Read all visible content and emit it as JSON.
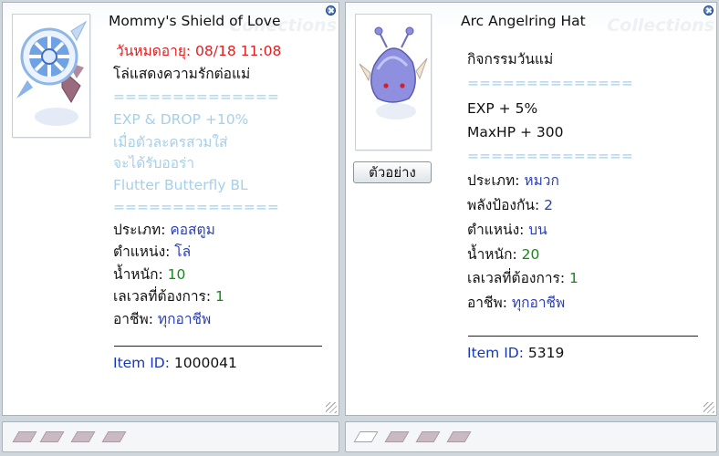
{
  "left_window": {
    "title": "Mommy's Shield of Love",
    "watermark": "Collections",
    "item_image": "shield-icon",
    "lines": {
      "expire": "วันหมดอายุ: 08/18 11:08",
      "desc": "โล่แสดงความรักต่อแม่",
      "sep1": "==============",
      "bonus1": "EXP & DROP +10%",
      "bonus2": "เมื่อตัวละครสวมใส่",
      "bonus3": "จะได้รับออร่า",
      "bonus4": "Flutter Butterfly BL",
      "sep2": "=============="
    },
    "stats": [
      {
        "label": "ประเภท: ",
        "value": "คอสตูม"
      },
      {
        "label": "ตำแหน่ง: ",
        "value": "โล่"
      },
      {
        "label": "น้ำหนัก: ",
        "value": "10"
      },
      {
        "label": "เลเวลที่ต้องการ: ",
        "value": "1"
      },
      {
        "label": "อาชีพ: ",
        "value": "ทุกอาชีพ"
      }
    ],
    "item_id_label": "Item ID: ",
    "item_id": "1000041"
  },
  "right_window": {
    "title": "Arc Angelring Hat",
    "watermark": "Collections",
    "item_image": "angelring-hat-icon",
    "preview_button": "ตัวอย่าง",
    "lines": {
      "desc": "กิจกรรมวันแม่",
      "sep1": "==============",
      "bonus1": "EXP + 5%",
      "bonus2": "MaxHP + 300",
      "sep2": "=============="
    },
    "stats": [
      {
        "label": "ประเภท: ",
        "value": "หมวก"
      },
      {
        "label": "พลังป้องกัน: ",
        "value": "2"
      },
      {
        "label": "ตำแหน่ง: ",
        "value": "บน"
      },
      {
        "label": "น้ำหนัก: ",
        "value": "20"
      },
      {
        "label": "เลเวลที่ต้องการ: ",
        "value": "1"
      },
      {
        "label": "อาชีพ: ",
        "value": "ทุกอาชีพ"
      }
    ],
    "item_id_label": "Item ID: ",
    "item_id": "5319"
  },
  "colors": {
    "expire": "#e31c1c",
    "faded": "#a6d0e8",
    "value_text": "#2a3fb6",
    "value_number": "#138b13",
    "item_id_label": "#1638b8"
  },
  "card_slots": {
    "left": [
      "filled",
      "filled",
      "filled",
      "filled"
    ],
    "right": [
      "empty",
      "filled",
      "filled",
      "filled"
    ]
  }
}
